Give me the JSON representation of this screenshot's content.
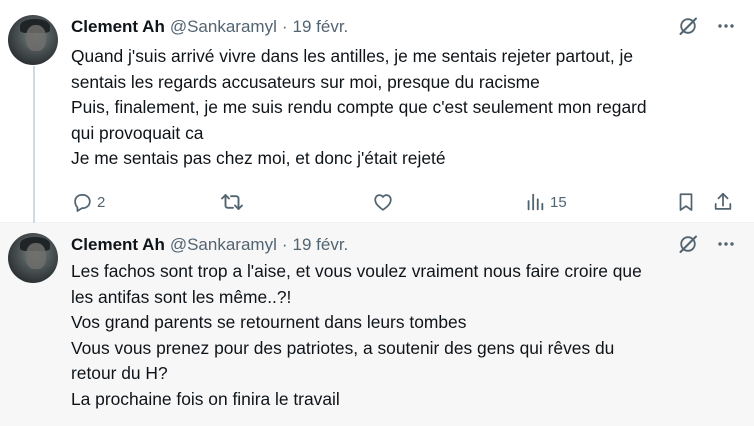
{
  "tweets": [
    {
      "author": {
        "name": "Clement Ah",
        "handle": "@Sankaramyl",
        "separator": "·",
        "date": "19 févr."
      },
      "avatar_icon": "user-avatar",
      "lines": [
        "Quand j'suis arrivé vivre dans les antilles, je me sentais rejeter partout, je",
        "sentais les regards accusateurs sur moi, presque du racisme",
        "Puis, finalement, je me suis rendu compte que c'est seulement mon regard",
        "qui provoquait ca",
        "Je me sentais pas chez moi, et donc j'était rejeté"
      ],
      "actions": {
        "replies": "2",
        "reposts": "",
        "likes": "",
        "views": "15"
      }
    },
    {
      "author": {
        "name": "Clement Ah",
        "handle": "@Sankaramyl",
        "separator": "·",
        "date": "19 févr."
      },
      "avatar_icon": "user-avatar",
      "lines": [
        "Les fachos sont trop a l'aise, et vous voulez vraiment nous faire croire que",
        "les antifas sont les même..?!",
        "Vos grand parents se retournent dans leurs tombes",
        "Vous vous prenez pour des patriotes, a soutenir des gens qui rêves du",
        "retour du H?",
        "La prochaine fois on finira le travail"
      ]
    }
  ],
  "icons": {
    "grok": "grok-icon",
    "more": "more-icon",
    "reply": "reply-icon",
    "repost": "repost-icon",
    "like": "like-icon",
    "views": "views-icon",
    "bookmark": "bookmark-icon",
    "share": "share-icon"
  },
  "colors": {
    "text": "#0f1419",
    "secondary": "#536471",
    "thread_line": "#cfd9de",
    "highlight_bg": "#f7f7f7"
  }
}
